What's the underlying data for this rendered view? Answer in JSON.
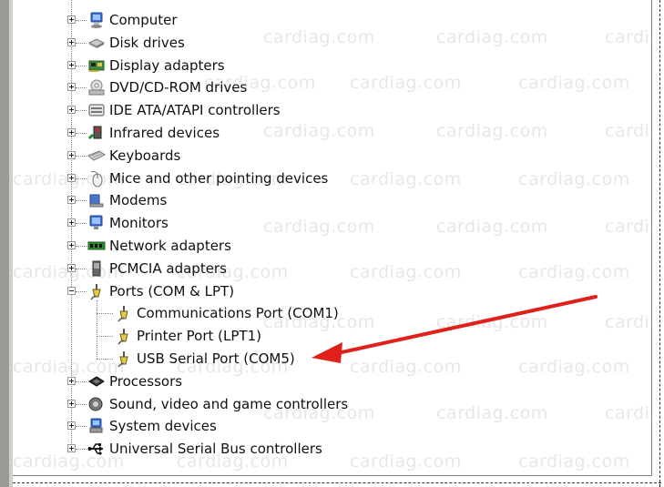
{
  "device_tree": {
    "categories": [
      {
        "label": "Computer",
        "icon": "computer-icon"
      },
      {
        "label": "Disk drives",
        "icon": "disk-drive-icon"
      },
      {
        "label": "Display adapters",
        "icon": "display-adapter-icon"
      },
      {
        "label": "DVD/CD-ROM drives",
        "icon": "dvd-drive-icon"
      },
      {
        "label": "IDE ATA/ATAPI controllers",
        "icon": "ide-controller-icon"
      },
      {
        "label": "Infrared devices",
        "icon": "infrared-icon"
      },
      {
        "label": "Keyboards",
        "icon": "keyboard-icon"
      },
      {
        "label": "Mice and other pointing devices",
        "icon": "mouse-icon"
      },
      {
        "label": "Modems",
        "icon": "modem-icon"
      },
      {
        "label": "Monitors",
        "icon": "monitor-icon"
      },
      {
        "label": "Network adapters",
        "icon": "network-adapter-icon"
      },
      {
        "label": "PCMCIA adapters",
        "icon": "pcmcia-icon"
      },
      {
        "label": "Ports (COM & LPT)",
        "icon": "port-icon",
        "expanded": true
      },
      {
        "label": "Processors",
        "icon": "processor-icon"
      },
      {
        "label": "Sound, video and game controllers",
        "icon": "sound-icon"
      },
      {
        "label": "System devices",
        "icon": "system-device-icon"
      },
      {
        "label": "Universal Serial Bus controllers",
        "icon": "usb-icon"
      }
    ],
    "ports_children": [
      {
        "label": "Communications Port (COM1)",
        "icon": "port-icon"
      },
      {
        "label": "Printer Port (LPT1)",
        "icon": "port-icon"
      },
      {
        "label": "USB Serial Port (COM5)",
        "icon": "port-icon"
      }
    ]
  },
  "watermark": "cardiag.com",
  "colors": {
    "arrow": "#e0201b",
    "watermark": "#e7e7e7"
  }
}
